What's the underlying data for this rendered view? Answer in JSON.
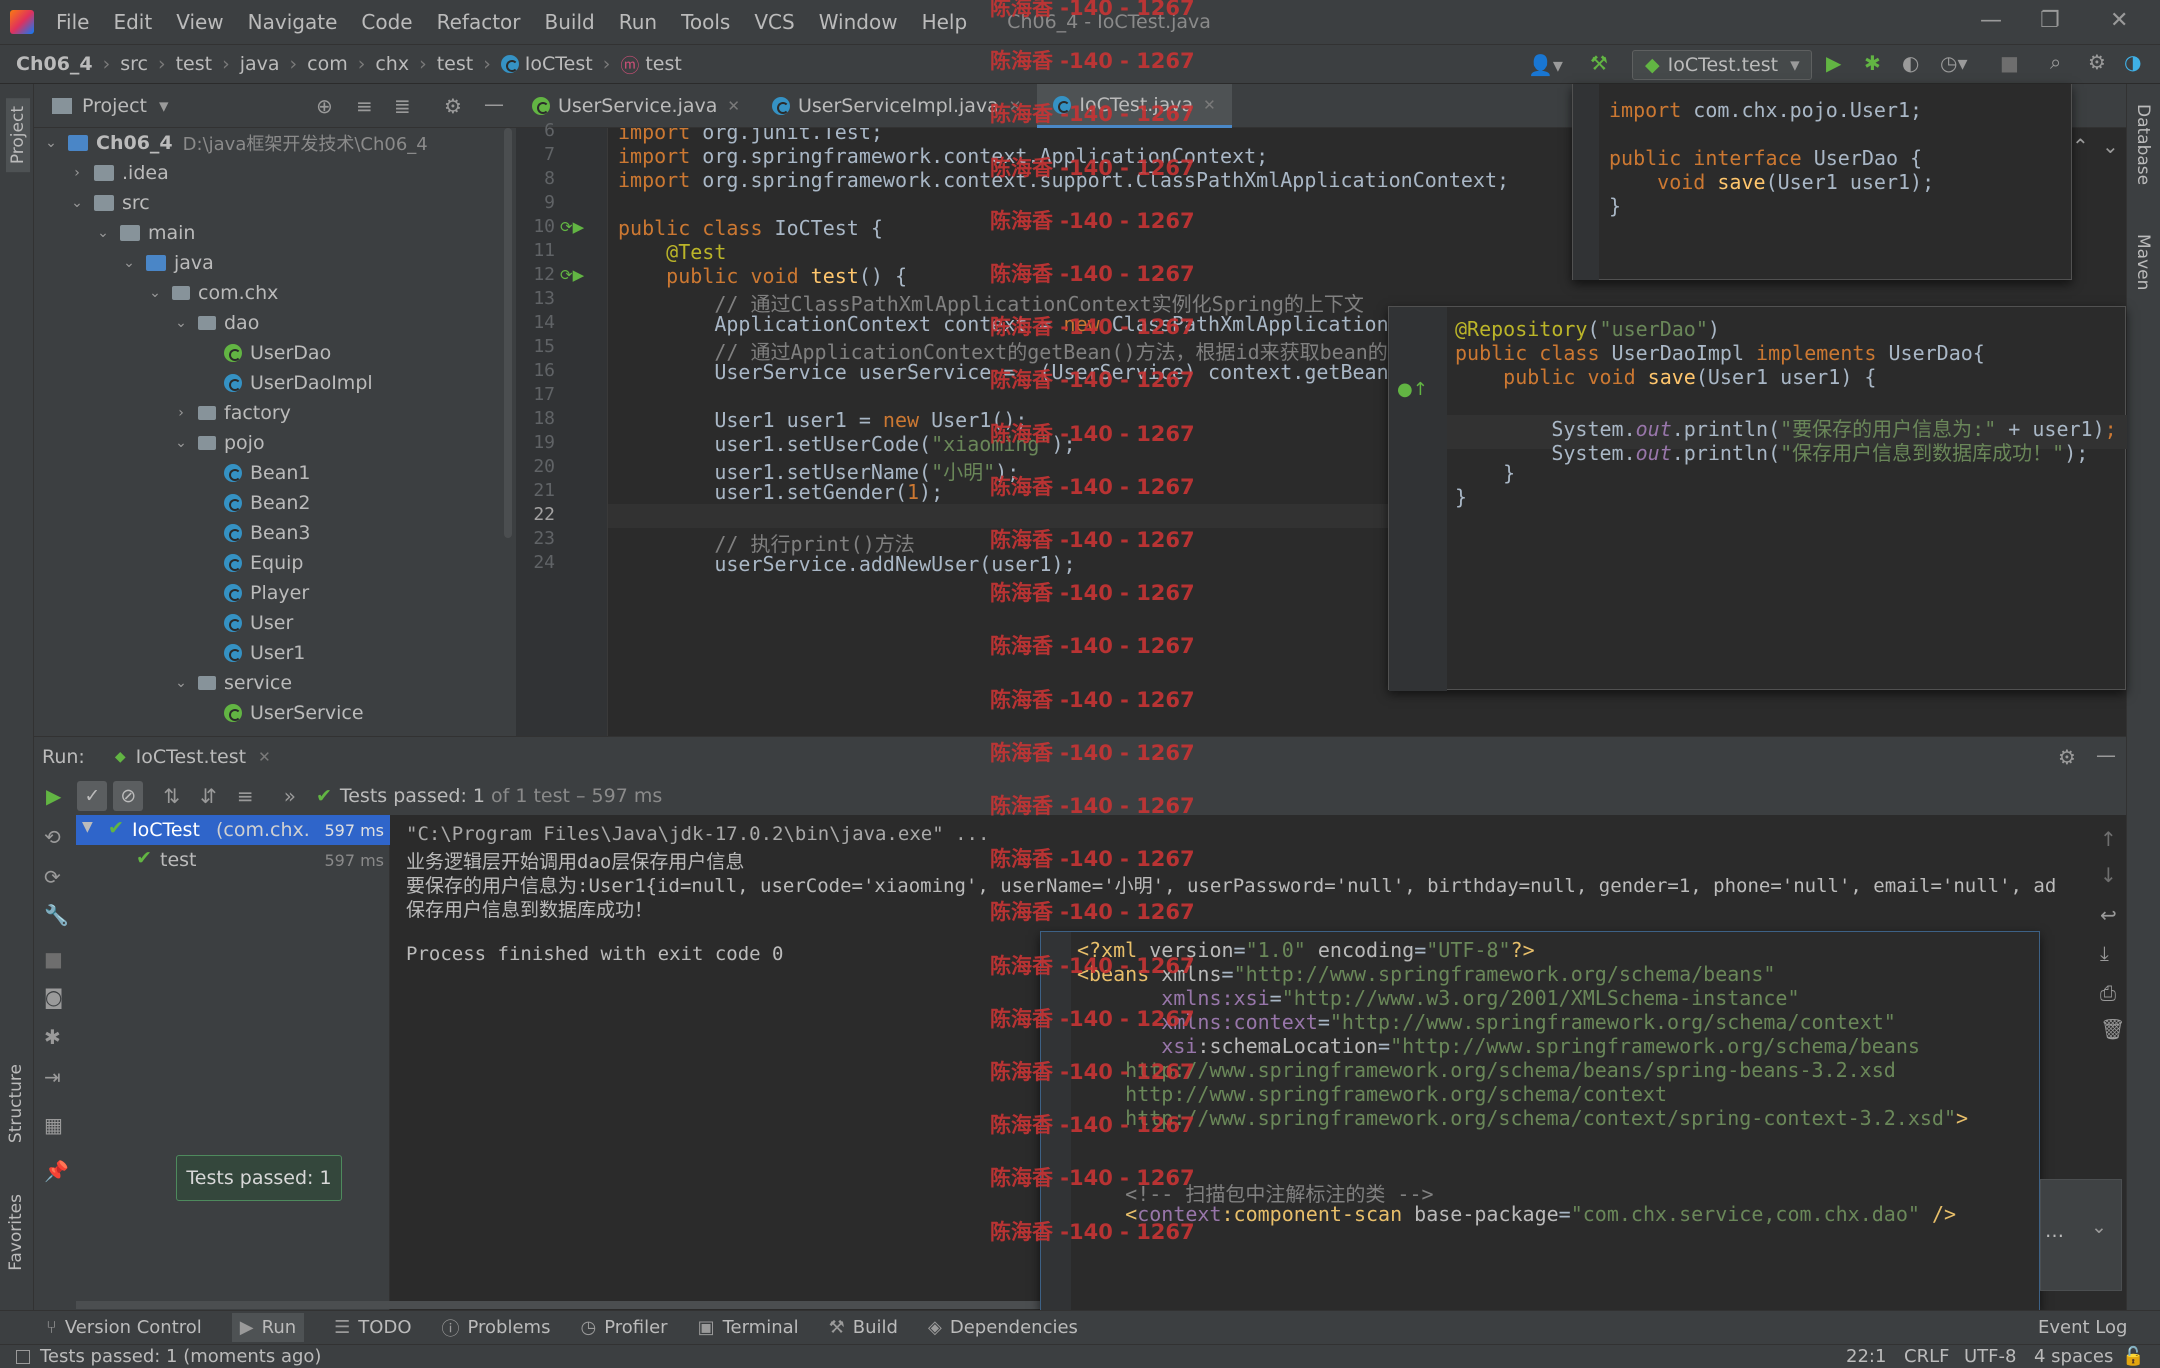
{
  "menu": [
    "File",
    "Edit",
    "View",
    "Navigate",
    "Code",
    "Refactor",
    "Build",
    "Run",
    "Tools",
    "VCS",
    "Window",
    "Help"
  ],
  "window_title": "Ch06_4 - IoCTest.java",
  "breadcrumb": [
    "Ch06_4",
    "src",
    "test",
    "java",
    "com",
    "chx",
    "test",
    "IoCTest",
    "test"
  ],
  "run_config": "IoCTest.test",
  "project_panel": {
    "title": "Project",
    "tree": [
      {
        "label": "Ch06_4",
        "extra": "D:\\java框架开发技术\\Ch06_4",
        "indent": 0,
        "arrow": "down",
        "type": "module"
      },
      {
        "label": ".idea",
        "indent": 1,
        "arrow": "right",
        "type": "folder"
      },
      {
        "label": "src",
        "indent": 1,
        "arrow": "down",
        "type": "folder"
      },
      {
        "label": "main",
        "indent": 2,
        "arrow": "down",
        "type": "folder"
      },
      {
        "label": "java",
        "indent": 3,
        "arrow": "down",
        "type": "srcfolder"
      },
      {
        "label": "com.chx",
        "indent": 4,
        "arrow": "down",
        "type": "package"
      },
      {
        "label": "dao",
        "indent": 5,
        "arrow": "down",
        "type": "package"
      },
      {
        "label": "UserDao",
        "indent": 6,
        "arrow": "",
        "type": "interface"
      },
      {
        "label": "UserDaoImpl",
        "indent": 6,
        "arrow": "",
        "type": "class"
      },
      {
        "label": "factory",
        "indent": 5,
        "arrow": "right",
        "type": "package"
      },
      {
        "label": "pojo",
        "indent": 5,
        "arrow": "down",
        "type": "package"
      },
      {
        "label": "Bean1",
        "indent": 6,
        "arrow": "",
        "type": "class"
      },
      {
        "label": "Bean2",
        "indent": 6,
        "arrow": "",
        "type": "class"
      },
      {
        "label": "Bean3",
        "indent": 6,
        "arrow": "",
        "type": "class"
      },
      {
        "label": "Equip",
        "indent": 6,
        "arrow": "",
        "type": "class"
      },
      {
        "label": "Player",
        "indent": 6,
        "arrow": "",
        "type": "class"
      },
      {
        "label": "User",
        "indent": 6,
        "arrow": "",
        "type": "class"
      },
      {
        "label": "User1",
        "indent": 6,
        "arrow": "",
        "type": "class"
      },
      {
        "label": "service",
        "indent": 5,
        "arrow": "down",
        "type": "package"
      },
      {
        "label": "UserService",
        "indent": 6,
        "arrow": "",
        "type": "interface"
      }
    ]
  },
  "tabs": [
    {
      "label": "UserService.java",
      "active": false
    },
    {
      "label": "UserServiceImpl.java",
      "active": false
    },
    {
      "label": "IoCTest.java",
      "active": true
    }
  ],
  "editor_lines": [
    {
      "n": "6",
      "html": "<span class=\"kw\">import</span> org.junit.Test;"
    },
    {
      "n": "7",
      "html": "<span class=\"kw\">import</span> org.springframework.context.ApplicationContext;"
    },
    {
      "n": "8",
      "html": "<span class=\"kw\">import</span> org.springframework.context.support.ClassPathXmlApplicationContext;"
    },
    {
      "n": "9",
      "html": ""
    },
    {
      "n": "10",
      "html": "<span class=\"kw\">public class</span> IoCTest {"
    },
    {
      "n": "11",
      "html": "    <span class=\"ann\">@Test</span>"
    },
    {
      "n": "12",
      "html": "    <span class=\"kw\">public void</span> <span class=\"fn\">test</span>() {"
    },
    {
      "n": "13",
      "html": "        <span class=\"cmt\">// 通过ClassPathXmlApplicationContext实例化Spring的上下文</span>"
    },
    {
      "n": "14",
      "html": "        ApplicationContext context = <span class=\"kw\">new</span> ClassPathXmlApplication"
    },
    {
      "n": "15",
      "html": "        <span class=\"cmt\">// 通过ApplicationContext的getBean()方法，根据id来获取bean的实</span>"
    },
    {
      "n": "16",
      "html": "        UserService userService =  (UserService) context.getBean("
    },
    {
      "n": "17",
      "html": ""
    },
    {
      "n": "18",
      "html": "        User1 user1 = <span class=\"kw\">new</span> User1();"
    },
    {
      "n": "19",
      "html": "        user1.setUserCode(<span class=\"str\">\"xiaoming\"</span>);"
    },
    {
      "n": "20",
      "html": "        user1.setUserName(<span class=\"str\">\"小明\"</span>);"
    },
    {
      "n": "21",
      "html": "        user1.setGender(<span class=\"kw\">1</span>);"
    },
    {
      "n": "22",
      "html": ""
    },
    {
      "n": "23",
      "html": "        <span class=\"cmt\">// 执行print()方法</span>"
    },
    {
      "n": "24",
      "html": "        userService.addNewUser(user1);"
    }
  ],
  "popup_userdao": [
    "<span class=\"kw\">import</span> com.chx.pojo.User1;",
    "",
    "<span class=\"kw\">public interface</span> UserDao {",
    "    <span class=\"kw\">void</span> <span class=\"fn\">save</span>(User1 user1);",
    "}"
  ],
  "popup_userdaoimpl": [
    "<span class=\"ann\">@Repository</span>(<span class=\"str\">\"userDao\"</span>)",
    "<span class=\"kw\">public class</span> UserDaoImpl <span class=\"kw\">implements</span> UserDao{",
    "    <span class=\"kw\">public void</span> <span class=\"fn\">save</span>(User1 user1) {",
    "",
    "        System.<span class=\"it\">out</span>.println(<span class=\"str\">\"要保存的用户信息为:\"</span> + user1)<span class=\"kw\">;</span>",
    "        System.<span class=\"it\">out</span>.println(<span class=\"str\">\"保存用户信息到数据库成功！\"</span>);",
    "    }",
    "}"
  ],
  "popup_xml": [
    "<span class=\"xmltag\">&lt;?xml </span><span class=\"xmlattr\">version</span>=<span class=\"xmlval\">\"1.0\"</span> <span class=\"xmlattr\">encoding</span>=<span class=\"xmlval\">\"UTF-8\"</span><span class=\"xmltag\">?&gt;</span>",
    "<span class=\"xmltag\">&lt;beans </span><span class=\"xmlattr\">xmlns</span>=<span class=\"xmlval\">\"http://www.springframework.org/schema/beans\"</span>",
    "       <span class=\"ns\">xmlns:xsi</span>=<span class=\"xmlval\">\"http://www.w3.org/2001/XMLSchema-instance\"</span>",
    "       <span class=\"ns\">xmlns:context</span>=<span class=\"xmlval\">\"http://www.springframework.org/schema/context\"</span>",
    "       <span class=\"ns\">xsi</span><span class=\"xmlattr\">:schemaLocation</span>=<span class=\"xmlval\">\"http://www.springframework.org/schema/beans</span>",
    "<span class=\"xmlval\">    http://www.springframework.org/schema/beans/spring-beans-3.2.xsd</span>",
    "<span class=\"xmlval\">    http://www.springframework.org/schema/context</span>",
    "<span class=\"xmlval\">    http://www.springframework.org/schema/context/spring-context-3.2.xsd\"</span><span class=\"xmltag\">&gt;</span>",
    "",
    "",
    "    <span class=\"cmt\">&lt;!-- 扫描包中注解标注的类 --&gt;</span>",
    "    <span class=\"xmltag\">&lt;</span><span class=\"ns\">context</span><span class=\"xmltag\">:component-scan </span><span class=\"xmlattr\">base-package</span>=<span class=\"xmlval\">\"com.chx.service,com.chx.dao\"</span> <span class=\"xmltag\">/&gt;</span>"
  ],
  "run": {
    "label": "Run:",
    "config": "IoCTest.test",
    "status": "Tests passed:",
    "status_count": "1",
    "status_tail": "of 1 test – 597 ms",
    "tree": [
      {
        "label": "IoCTest",
        "sub": "(com.chx.",
        "time": "597 ms"
      },
      {
        "label": "test",
        "sub": "",
        "time": "597 ms"
      }
    ],
    "console": [
      "\"C:\\Program Files\\Java\\jdk-17.0.2\\bin\\java.exe\" ...",
      "业务逻辑层开始调用dao层保存用户信息",
      "要保存的用户信息为:User1{id=null, userCode='xiaoming', userName='小明', userPassword='null', birthday=null, gender=1, phone='null', email='null', ad",
      "保存用户信息到数据库成功！",
      "",
      "Process finished with exit code 0"
    ],
    "tooltip": "Tests passed: 1"
  },
  "bottom_tabs": [
    "Version Control",
    "Run",
    "TODO",
    "Problems",
    "Profiler",
    "Terminal",
    "Build",
    "Dependencies"
  ],
  "event_log": "Event Log",
  "status": {
    "message": "Tests passed: 1 (moments ago)",
    "position": "22:1",
    "line_sep": "CRLF",
    "encoding": "UTF-8",
    "indent": "4 spaces"
  },
  "side_labels": {
    "project": "Project",
    "structure": "Structure",
    "favorites": "Favorites",
    "database": "Database",
    "maven": "Maven"
  },
  "watermark": "陈海香 -140 - 1267",
  "watermark_rows": 24
}
